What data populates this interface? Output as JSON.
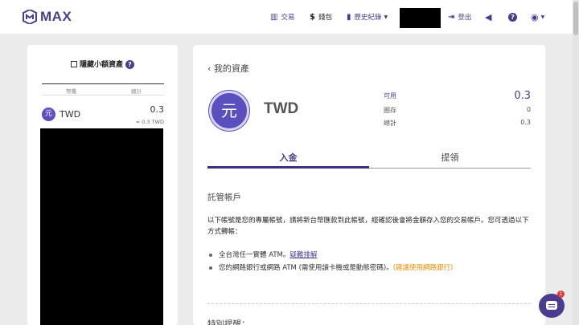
{
  "brand": {
    "name": "MAX",
    "color": "#4b3c8f"
  },
  "nav": {
    "trade": "交易",
    "wallet": "錢包",
    "history": "歷史紀錄",
    "logout": "登出"
  },
  "sidebar": {
    "hide_small": "隱藏小額資產",
    "help": "?",
    "col_currency": "幣種",
    "col_total": "總計",
    "coin_icon": "元",
    "coin_name": "TWD",
    "coin_value": "0.3",
    "coin_approx": "≈ 0.3 TWD"
  },
  "main": {
    "back": "我的資產",
    "coin_icon": "元",
    "coin_name": "TWD",
    "available_label": "可用",
    "available_value": "0.3",
    "locked_label": "圈存",
    "locked_value": "0",
    "total_label": "總計",
    "total_value": "0.3",
    "tab_deposit": "入金",
    "tab_withdraw": "提領",
    "section_title": "託管帳戶",
    "description": "以下帳號是您的專屬帳號，請將新台幣匯款到此帳號，經確認後會將金額存入您的交易帳戶。您可透過以下方式轉帳：",
    "bullet1_text": "全台灣任一實體 ATM。",
    "bullet1_link": "疑難排解",
    "bullet2_text": "您的網路銀行或網路 ATM (需使用讀卡機或是動態密碼)。",
    "bullet2_note": "(建議使用網路銀行)",
    "notice_title": "特別提醒："
  },
  "chat": {
    "badge": "1"
  }
}
